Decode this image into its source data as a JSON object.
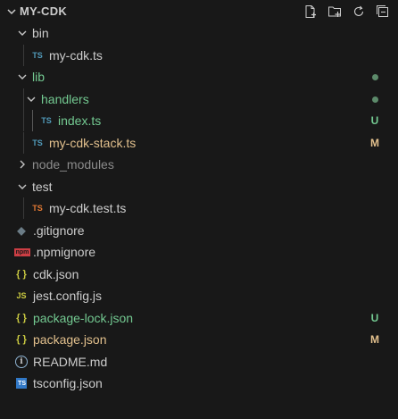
{
  "explorer": {
    "title": "MY-CDK",
    "actions": [
      {
        "name": "new-file-button",
        "icon": "new-file-icon"
      },
      {
        "name": "new-folder-button",
        "icon": "new-folder-icon"
      },
      {
        "name": "refresh-button",
        "icon": "refresh-icon"
      },
      {
        "name": "collapse-all-button",
        "icon": "collapse-all-icon"
      }
    ]
  },
  "tree": [
    {
      "label": "bin",
      "kind": "folder",
      "expanded": true,
      "icon_glyph": "",
      "icon_name": "chevron-down-icon",
      "color": "#cccccc",
      "status": ""
    },
    {
      "label": "my-cdk.ts",
      "kind": "file",
      "icon_glyph": "TS",
      "icon_name": "typescript-file-icon",
      "icon_color": "#519aba",
      "color": "#cccccc",
      "status": ""
    },
    {
      "label": "lib",
      "kind": "folder",
      "expanded": true,
      "icon_name": "chevron-down-icon",
      "color": "#73c991",
      "status": "dot"
    },
    {
      "label": "handlers",
      "kind": "folder",
      "expanded": true,
      "icon_name": "chevron-down-icon",
      "color": "#73c991",
      "status": "dot"
    },
    {
      "label": "index.ts",
      "kind": "file",
      "icon_glyph": "TS",
      "icon_name": "typescript-file-icon",
      "icon_color": "#519aba",
      "color": "#73c991",
      "status": "U"
    },
    {
      "label": "my-cdk-stack.ts",
      "kind": "file",
      "icon_glyph": "TS",
      "icon_name": "typescript-file-icon",
      "icon_color": "#519aba",
      "color": "#e2c08d",
      "status": "M"
    },
    {
      "label": "node_modules",
      "kind": "folder",
      "expanded": false,
      "icon_name": "chevron-right-icon",
      "color": "#8c8c8c",
      "status": ""
    },
    {
      "label": "test",
      "kind": "folder",
      "expanded": true,
      "icon_name": "chevron-down-icon",
      "color": "#cccccc",
      "status": ""
    },
    {
      "label": "my-cdk.test.ts",
      "kind": "file",
      "icon_glyph": "TS",
      "icon_name": "typescript-test-file-icon",
      "icon_color": "#e37933",
      "color": "#cccccc",
      "status": ""
    },
    {
      "label": ".gitignore",
      "kind": "file",
      "icon_glyph": "◆",
      "icon_name": "git-icon",
      "icon_color": "#41535b",
      "color": "#cccccc",
      "status": ""
    },
    {
      "label": ".npmignore",
      "kind": "file",
      "icon_glyph": "npm",
      "icon_name": "npm-icon",
      "icon_color": "#cc3e44",
      "color": "#cccccc",
      "status": ""
    },
    {
      "label": "cdk.json",
      "kind": "file",
      "icon_glyph": "{ }",
      "icon_name": "json-icon",
      "icon_color": "#cbcb41",
      "color": "#cccccc",
      "status": ""
    },
    {
      "label": "jest.config.js",
      "kind": "file",
      "icon_glyph": "JS",
      "icon_name": "javascript-file-icon",
      "icon_color": "#cbcb41",
      "color": "#cccccc",
      "status": ""
    },
    {
      "label": "package-lock.json",
      "kind": "file",
      "icon_glyph": "{ }",
      "icon_name": "json-icon",
      "icon_color": "#cbcb41",
      "color": "#73c991",
      "status": "U"
    },
    {
      "label": "package.json",
      "kind": "file",
      "icon_glyph": "{ }",
      "icon_name": "json-icon",
      "icon_color": "#cbcb41",
      "color": "#e2c08d",
      "status": "M"
    },
    {
      "label": "README.md",
      "kind": "file",
      "icon_glyph": "i",
      "icon_name": "info-icon",
      "icon_color": "#519aba",
      "color": "#cccccc",
      "status": ""
    },
    {
      "label": "tsconfig.json",
      "kind": "file",
      "icon_glyph": "TS",
      "icon_name": "tsconfig-icon",
      "icon_color": "#519aba",
      "color": "#cccccc",
      "status": ""
    }
  ],
  "colors": {
    "background": "#181818",
    "untracked": "#73c991",
    "modified": "#e2c08d",
    "ignored": "#8c8c8c"
  }
}
